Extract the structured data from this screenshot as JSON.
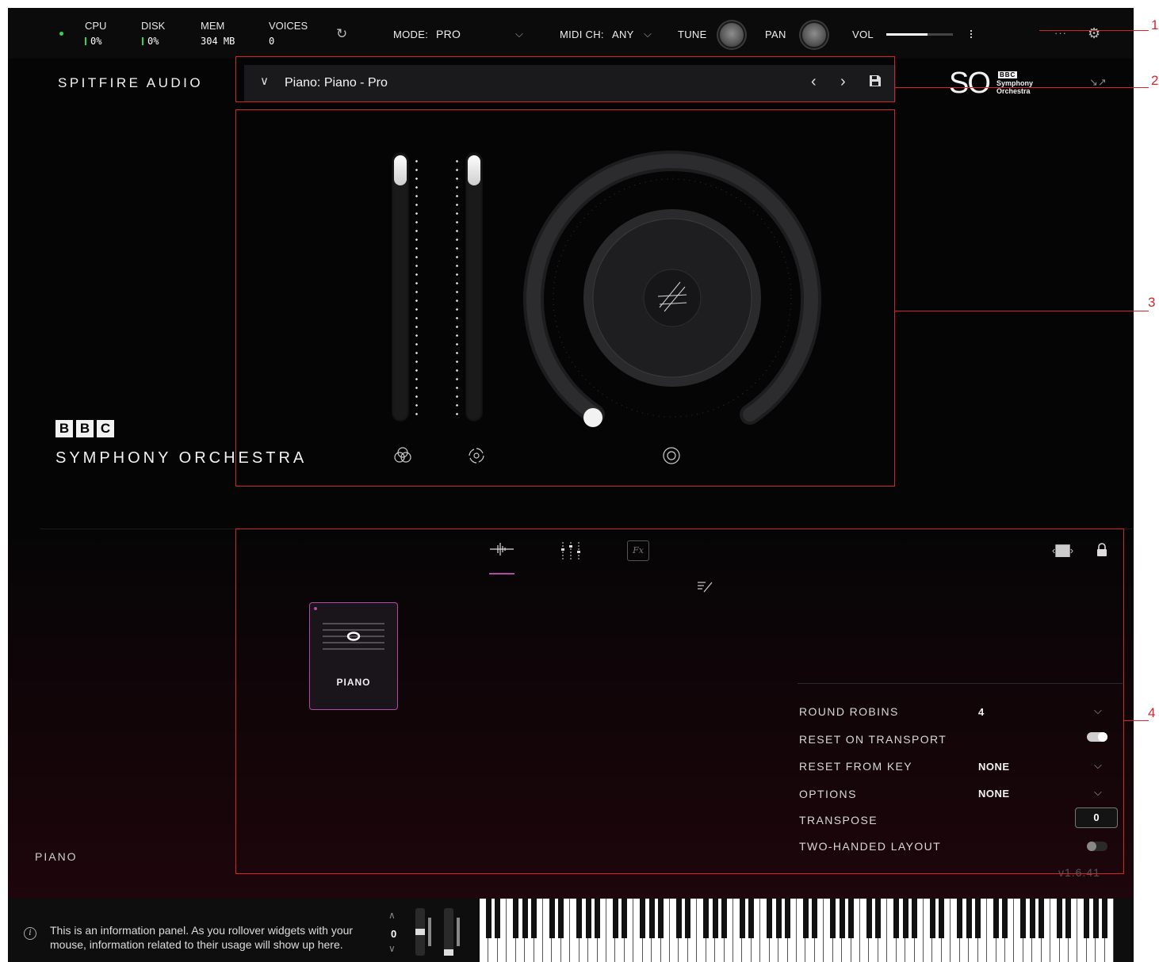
{
  "topbar": {
    "cpu_label": "CPU",
    "cpu_value": "0%",
    "disk_label": "DISK",
    "disk_value": "0%",
    "mem_label": "MEM",
    "mem_value": "304 MB",
    "voices_label": "VOICES",
    "voices_value": "0",
    "mode_label": "MODE:",
    "mode_value": "PRO",
    "midi_label": "MIDI CH:",
    "midi_value": "ANY",
    "tune_label": "TUNE",
    "pan_label": "PAN",
    "vol_label": "VOL",
    "vol_level": 0.62,
    "more_label": "···"
  },
  "brand": {
    "company": "SPITFIRE AUDIO",
    "bbc_letters": [
      "B",
      "B",
      "C"
    ],
    "product": "SYMPHONY ORCHESTRA",
    "so_logo_text": "SO",
    "so_bbc": "BBC",
    "so_line1": "Symphony",
    "so_line2": "Orchestra"
  },
  "preset": {
    "name": "Piano: Piano - Pro"
  },
  "articulation": {
    "label": "PIANO"
  },
  "instrument_name": "PIANO",
  "params": {
    "round_robins": {
      "label": "ROUND ROBINS",
      "value": "4"
    },
    "reset_transport": {
      "label": "RESET ON TRANSPORT",
      "on": true
    },
    "reset_key": {
      "label": "RESET FROM KEY",
      "value": "NONE"
    },
    "options": {
      "label": "OPTIONS",
      "value": "NONE"
    },
    "transpose": {
      "label": "TRANSPOSE",
      "value": "0"
    },
    "two_handed": {
      "label": "TWO-HANDED LAYOUT",
      "on": false
    }
  },
  "version": "v1.6.41",
  "info_panel": {
    "line1": "This is an information panel. As you rollover widgets with your",
    "line2": "mouse, information related to their usage will show up here."
  },
  "octave_value": "0",
  "callouts": [
    "1",
    "2",
    "3",
    "4"
  ],
  "colors": {
    "accent": "#b24aa8",
    "callout": "#d4242b",
    "meter": "#2fd45a"
  }
}
